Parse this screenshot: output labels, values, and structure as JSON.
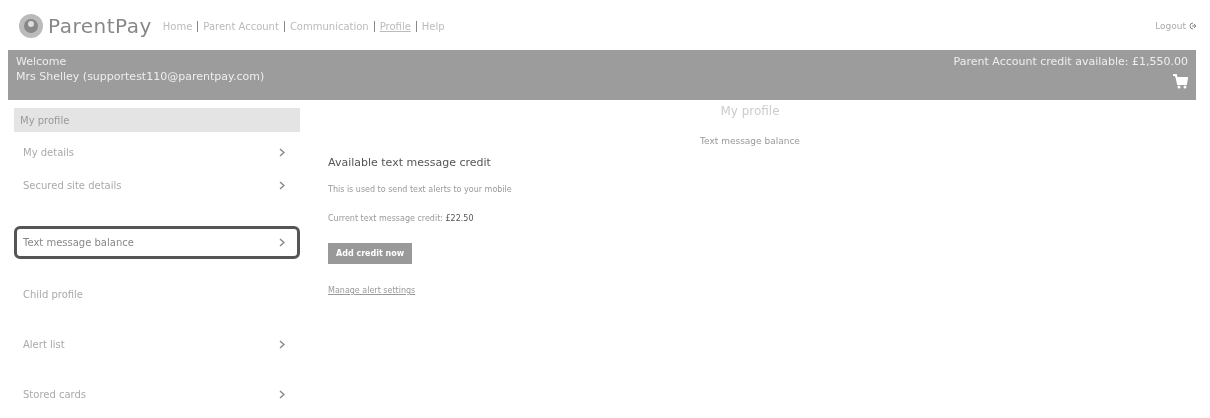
{
  "logo": "ParentPay",
  "nav": [
    {
      "label": "Home",
      "selected": false
    },
    {
      "label": "Parent Account",
      "selected": false
    },
    {
      "label": "Communication",
      "selected": false
    },
    {
      "label": "Profile",
      "selected": true
    },
    {
      "label": "Help",
      "selected": false
    }
  ],
  "logout": "Logout",
  "banner": {
    "welcome": "Welcome",
    "user": "Mrs Shelley (supportest110@parentpay.com)",
    "credit": "Parent Account credit available: £1,550.00"
  },
  "sidebar": {
    "header": "My profile",
    "items": [
      {
        "label": "My details",
        "chevron": true,
        "selected": false
      },
      {
        "label": "Secured site details",
        "chevron": true,
        "selected": false
      },
      {
        "label": "Text message balance",
        "chevron": true,
        "selected": true
      },
      {
        "label": "Child profile",
        "chevron": false,
        "selected": false
      },
      {
        "label": "Alert list",
        "chevron": true,
        "selected": false
      },
      {
        "label": "Stored cards",
        "chevron": true,
        "selected": false
      }
    ]
  },
  "page_title": "My profile",
  "page_subtitle": "Text message balance",
  "panel": {
    "heading": "Available text message credit",
    "description": "This is used to send text alerts to your mobile",
    "credit_line": "Current text message credit: **£22.50**",
    "button": "Add credit now",
    "link": "Manage alert settings"
  }
}
